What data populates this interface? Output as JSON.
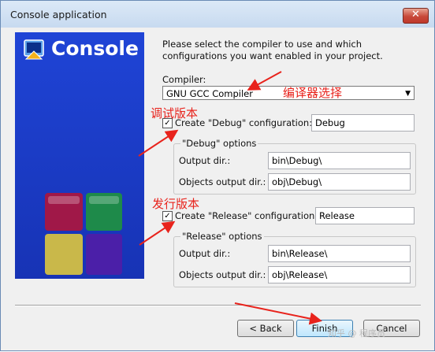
{
  "window": {
    "title": "Console application",
    "close_symbol": "✕"
  },
  "logo": {
    "text": "Console"
  },
  "intro": "Please select the compiler to use and which configurations you want enabled in your project.",
  "compiler": {
    "label": "Compiler:",
    "value": "GNU GCC Compiler"
  },
  "debug": {
    "checkbox_label": "Create \"Debug\" configuration:",
    "checked": true,
    "name": "Debug",
    "group_title": "\"Debug\" options",
    "output_label": "Output dir.:",
    "output_value": "bin\\Debug\\",
    "objects_label": "Objects output dir.:",
    "objects_value": "obj\\Debug\\"
  },
  "release": {
    "checkbox_label": "Create \"Release\" configuration:",
    "checked": true,
    "name": "Release",
    "group_title": "\"Release\" options",
    "output_label": "Output dir.:",
    "output_value": "bin\\Release\\",
    "objects_label": "Objects output dir.:",
    "objects_value": "obj\\Release\\"
  },
  "buttons": {
    "back": "< Back",
    "finish": "Finish",
    "cancel": "Cancel"
  },
  "annotations": {
    "compiler_note": "编译器选择",
    "debug_note": "调试版本",
    "release_note": "发行版本"
  },
  "colors": {
    "annotation": "#e8231c",
    "panel": "#1f44d6"
  },
  "watermark": "知乎 @ 程序员"
}
